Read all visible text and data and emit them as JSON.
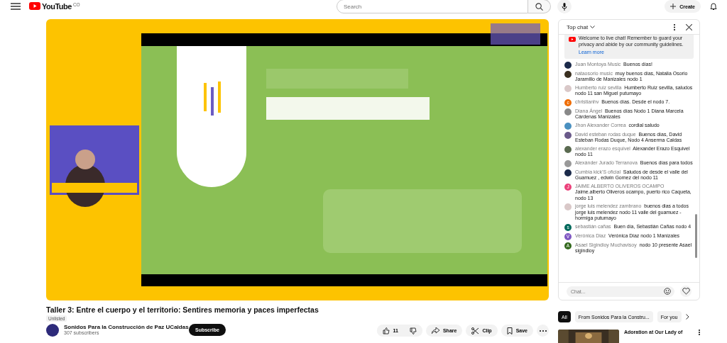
{
  "header": {
    "logo": "YouTube",
    "country": "CO",
    "search": {
      "placeholder": "Search"
    },
    "create": "Create"
  },
  "chat": {
    "title": "Top chat",
    "welcome": "Welcome to live chat! Remember to guard your privacy and abide by our community guidelines.",
    "learn_more": "Learn more",
    "placeholder": "Chat...",
    "messages": [
      {
        "author": "Juan Montoya Music",
        "text": "Buenos días!"
      },
      {
        "author": "nataosorio music",
        "text": "muy buenos días, Natalia Osorio Jaramillo de Manizales nodo 1"
      },
      {
        "author": "Humberto ruiz sevilla",
        "text": "Humberto Ruiz sevilla, saludos nodo 11 san Miguel putumayo"
      },
      {
        "author": "christianhv",
        "text": "Buenos días. Desde el nodo 7.",
        "kind": "letter",
        "letter": "c",
        "color": "#ef6c00"
      },
      {
        "author": "Diana Ángel",
        "text": "Buenos días Nodo 1 Diana Marcela Cárdenas Manizales"
      },
      {
        "author": "Jhon Alexander Correa",
        "text": "cordial saludo"
      },
      {
        "author": "David esteban rodas duque",
        "text": "Buenos días, David Esteban Rodas Duque, Nodo 4 Anserma Caldas"
      },
      {
        "author": "alexander erazo esquivel",
        "text": "Alexander Erazo Esquivel nodo 11"
      },
      {
        "author": "Alexánder Jurado Terranova",
        "text": "Buenos días para todos"
      },
      {
        "author": "Cumbia kick'S oficial",
        "text": "Saludos de desde el valle del Guamuez , edwin Gomez del nodo 11"
      },
      {
        "author": "JAIME ALBERTO OLIVEROS OCAMPO",
        "text": "Jaime.alberto Oliveros ocampo, puerto rico Caqueta, nodo 13",
        "kind": "letter",
        "letter": "J",
        "color": "#ec407a"
      },
      {
        "author": "jorge luis melendez zambrano",
        "text": "buenos dias a todos jorge luis melendez nodo 11 valle del guamuez - hormiga putumayo"
      },
      {
        "author": "sebastián cañas",
        "text": "Buen día, Sebastián Cañas nodo 4",
        "kind": "letter",
        "letter": "s",
        "color": "#00695c"
      },
      {
        "author": "Verónica Diaz",
        "text": "Verónica Diaz nodo 1 Manizales",
        "kind": "letter",
        "letter": "V",
        "color": "#7e57c2"
      },
      {
        "author": "Asael Sigindioy Muchavisoy",
        "text": "nodo 10 presente Asael sigindioy",
        "kind": "letter",
        "letter": "A",
        "color": "#33691e"
      }
    ]
  },
  "title": "Taller 3: Entre el cuerpo y el territorio: Sentires memoria y paces imperfectas",
  "badge": "Unlisted",
  "channel": {
    "name": "Sonidos Para la Construcción de Paz UCaldas",
    "subscribers": "307 subscribers",
    "subscribe": "Subscribe"
  },
  "actions": {
    "likes": "11",
    "share": "Share",
    "clip": "Clip",
    "save": "Save"
  },
  "chips": [
    {
      "label": "All",
      "selected": true
    },
    {
      "label": "From Sonidos Para la Constru...",
      "selected": false
    },
    {
      "label": "For you",
      "selected": false
    }
  ],
  "recommended": {
    "title": "Adoration at Our Lady of"
  }
}
